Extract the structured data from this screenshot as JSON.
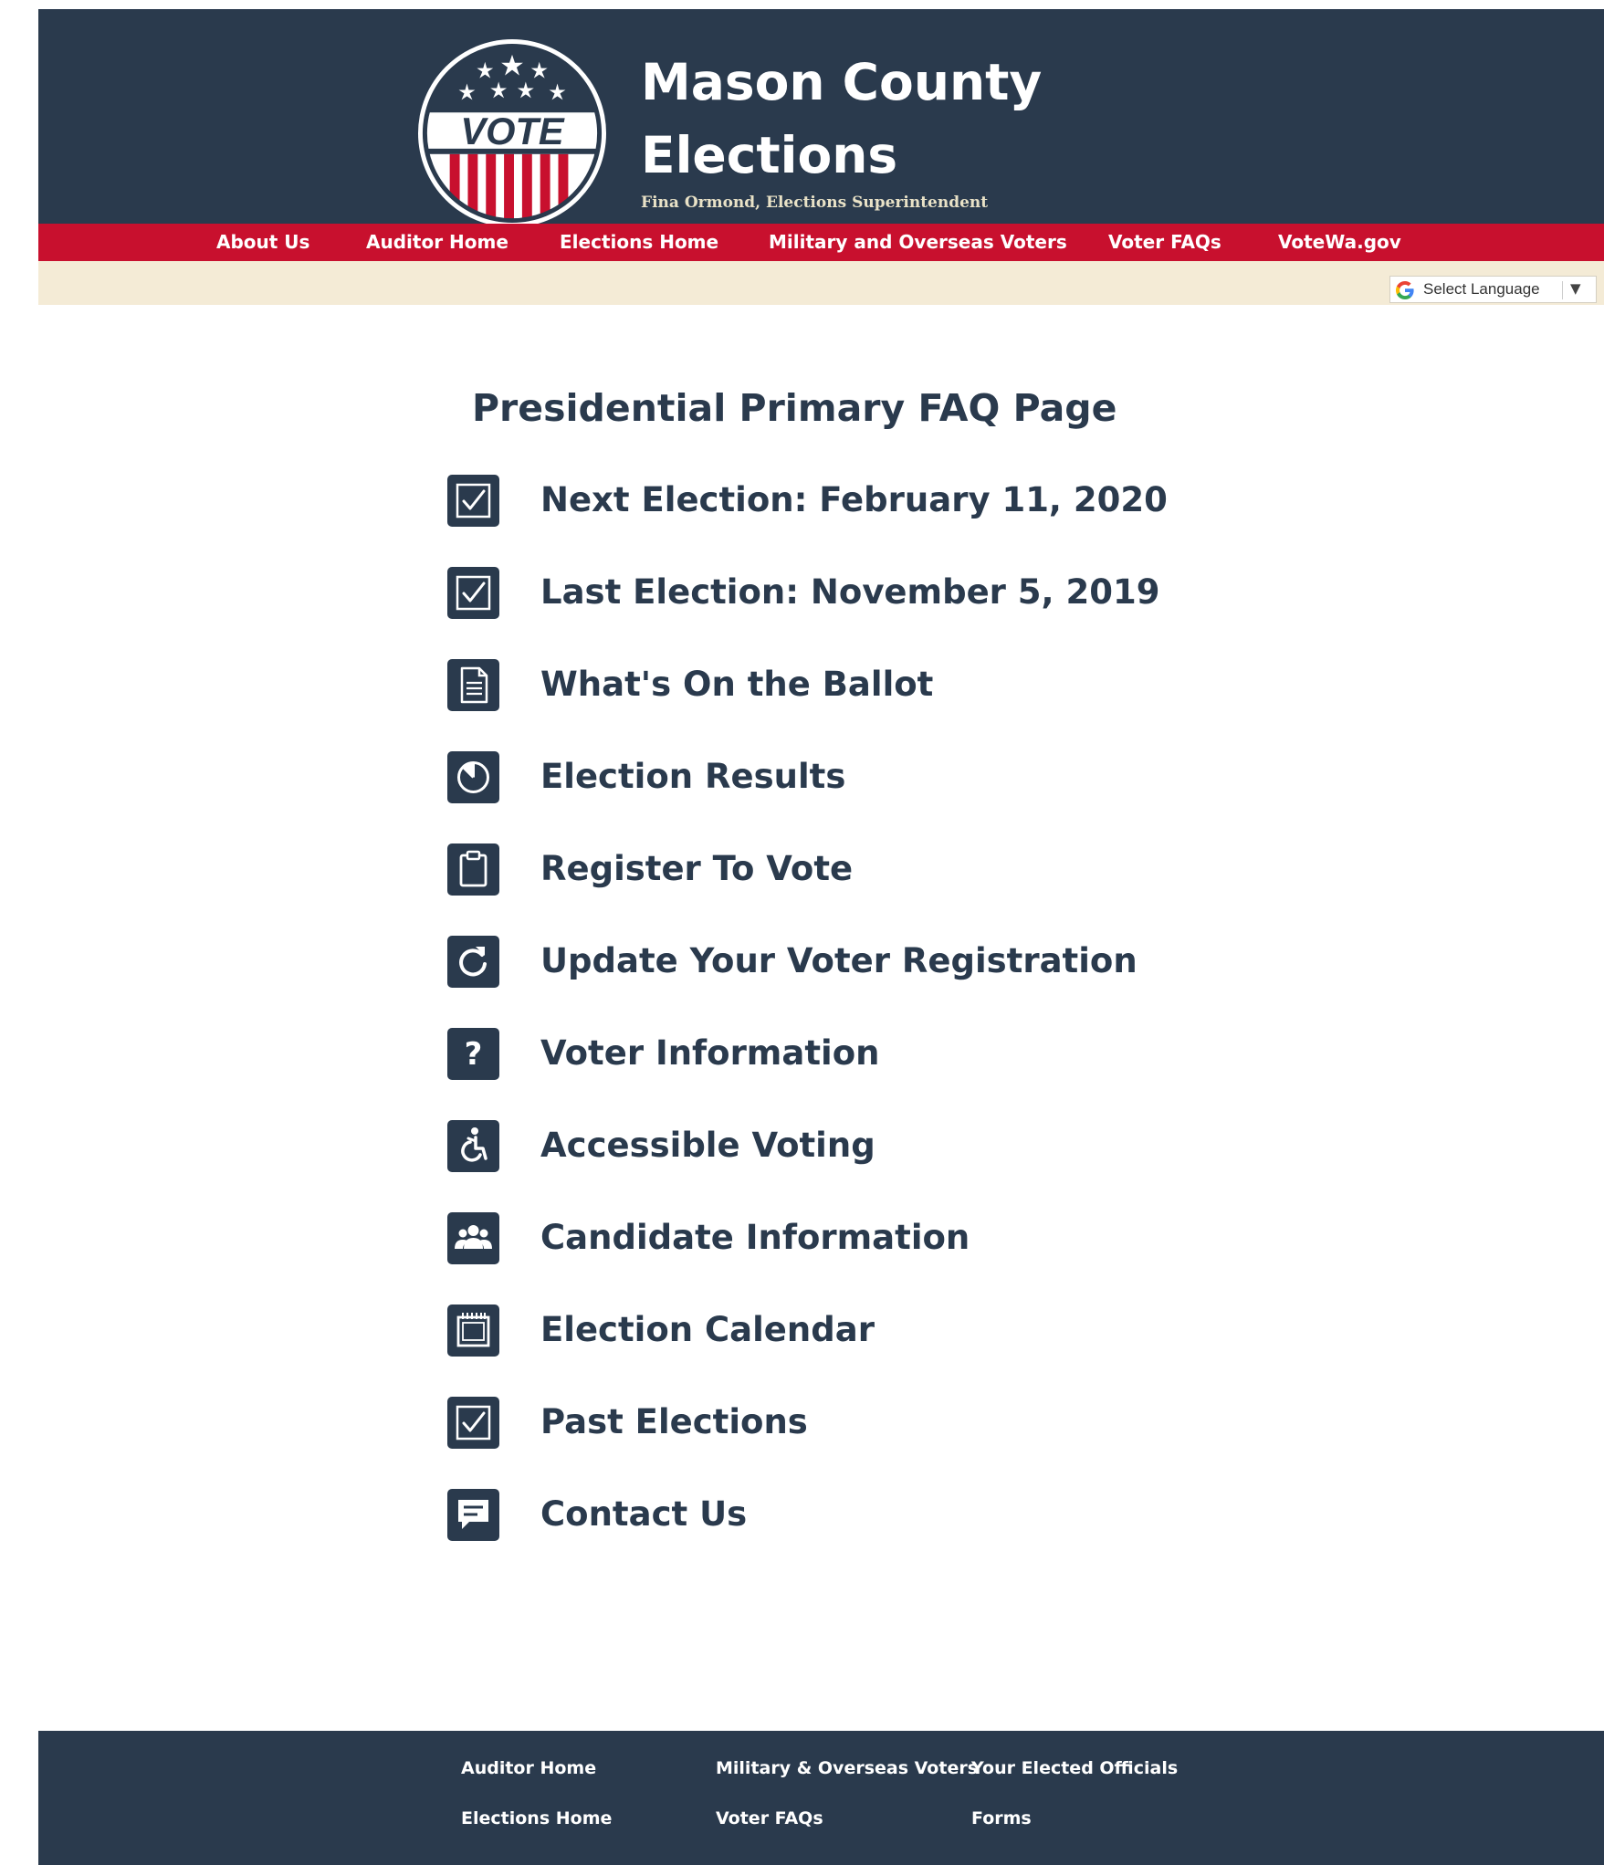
{
  "header": {
    "title_line1": "Mason County",
    "title_line2": "Elections",
    "subtitle": "Fina Ormond, Elections Superintendent",
    "logo_text": "VOTE"
  },
  "nav": {
    "items": [
      {
        "label": "About Us"
      },
      {
        "label": "Auditor Home"
      },
      {
        "label": "Elections Home"
      },
      {
        "label": "Military and Overseas Voters"
      },
      {
        "label": "Voter FAQs"
      },
      {
        "label": "VoteWa.gov"
      }
    ]
  },
  "language": {
    "label": "Select Language",
    "caret": "▼"
  },
  "main": {
    "title": "Presidential Primary FAQ Page",
    "items": [
      {
        "label": "Next Election: February 11, 2020",
        "icon": "checkbox-icon"
      },
      {
        "label": "Last Election: November 5, 2019",
        "icon": "checkbox-icon"
      },
      {
        "label": "What's On the Ballot",
        "icon": "document-icon"
      },
      {
        "label": "Election Results",
        "icon": "pie-chart-icon"
      },
      {
        "label": "Register To Vote",
        "icon": "clipboard-icon"
      },
      {
        "label": "Update Your Voter Registration",
        "icon": "refresh-icon"
      },
      {
        "label": "Voter Information",
        "icon": "question-icon"
      },
      {
        "label": "Accessible Voting",
        "icon": "accessibility-icon"
      },
      {
        "label": "Candidate Information",
        "icon": "people-icon"
      },
      {
        "label": "Election Calendar",
        "icon": "calendar-icon"
      },
      {
        "label": "Past Elections",
        "icon": "checkbox-icon"
      },
      {
        "label": "Contact Us",
        "icon": "chat-icon"
      }
    ]
  },
  "footer": {
    "links": [
      {
        "label": "Auditor Home"
      },
      {
        "label": "Military & Overseas Voters"
      },
      {
        "label": "Your Elected Officials"
      },
      {
        "label": "Elections Home"
      },
      {
        "label": "Voter FAQs"
      },
      {
        "label": "Forms"
      }
    ]
  },
  "colors": {
    "navy": "#2a3a4d",
    "red": "#c8102e",
    "cream": "#f4ebd6"
  }
}
